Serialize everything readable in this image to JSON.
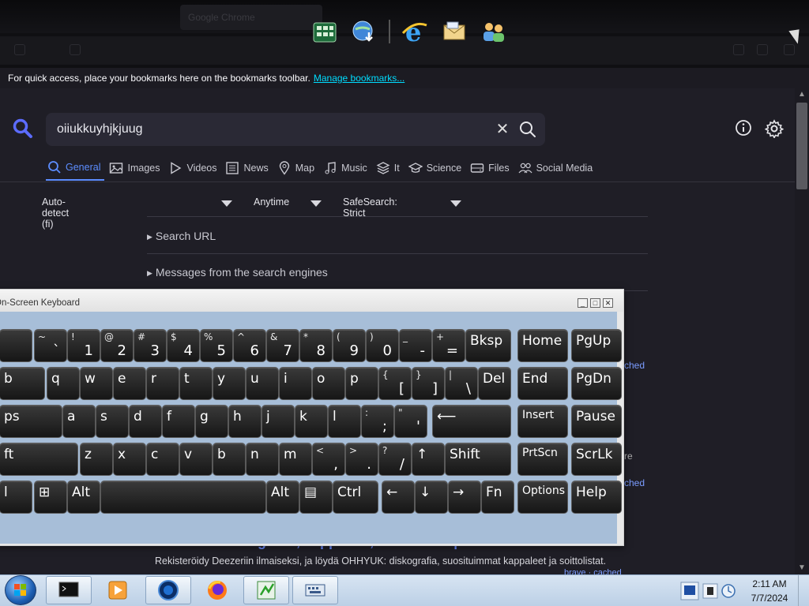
{
  "browser": {
    "tab_title": "Google Chrome",
    "bookmarks_bar": {
      "message": "For quick access, place your bookmarks here on the bookmarks toolbar.",
      "link": "Manage bookmarks..."
    }
  },
  "quick_launch": [
    {
      "icon": "app-grid-icon"
    },
    {
      "icon": "globe-download-icon"
    },
    {
      "icon": "internet-explorer-icon"
    },
    {
      "icon": "mail-icon"
    },
    {
      "icon": "users-icon"
    }
  ],
  "search": {
    "query": "oiiukkuyhjkjuug",
    "categories": [
      {
        "label": "General",
        "icon": "search-icon",
        "active": true
      },
      {
        "label": "Images",
        "icon": "image-icon"
      },
      {
        "label": "Videos",
        "icon": "play-icon"
      },
      {
        "label": "News",
        "icon": "newspaper-icon"
      },
      {
        "label": "Map",
        "icon": "map-pin-icon"
      },
      {
        "label": "Music",
        "icon": "music-icon"
      },
      {
        "label": "It",
        "icon": "layers-icon"
      },
      {
        "label": "Science",
        "icon": "graduation-cap-icon"
      },
      {
        "label": "Files",
        "icon": "drive-icon"
      },
      {
        "label": "Social Media",
        "icon": "people-icon"
      }
    ],
    "filters": {
      "language": "Auto-detect (fi)",
      "time": "Anytime",
      "safesearch": "SafeSearch: Strict"
    },
    "disclosures": {
      "search_url": "Search URL",
      "messages": "Messages from the search engines"
    },
    "side_snippets": {
      "cached1": "ched",
      "re": "re",
      "cached2": "ched"
    },
    "result": {
      "title": "OHHYUK diskografia, kappaleet, soittolistat | Kuuntele Deezerissä",
      "description": "Rekisteröidy Deezeriin ilmaiseksi, ja löydä OHHYUK: diskografia, suosituimmat kappaleet ja soittolistat.",
      "meta": "brave  ·  cached"
    }
  },
  "osk": {
    "title": "On-Screen Keyboard",
    "rows": [
      [
        {
          "top": "",
          "bot": "",
          "lbl": ""
        },
        {
          "top": "~",
          "bot": "`"
        },
        {
          "top": "!",
          "bot": "1"
        },
        {
          "top": "@",
          "bot": "2"
        },
        {
          "top": "#",
          "bot": "3"
        },
        {
          "top": "$",
          "bot": "4"
        },
        {
          "top": "%",
          "bot": "5"
        },
        {
          "top": "^",
          "bot": "6"
        },
        {
          "top": "&",
          "bot": "7"
        },
        {
          "top": "*",
          "bot": "8"
        },
        {
          "top": "(",
          "bot": "9"
        },
        {
          "top": ")",
          "bot": "0"
        },
        {
          "top": "_",
          "bot": "-"
        },
        {
          "top": "+",
          "bot": "="
        },
        {
          "lbl": "Bksp"
        },
        {
          "lbl": "Home"
        },
        {
          "lbl": "PgUp"
        }
      ],
      [
        {
          "lbl": "b"
        },
        {
          "lbl": "q"
        },
        {
          "lbl": "w"
        },
        {
          "lbl": "e"
        },
        {
          "lbl": "r"
        },
        {
          "lbl": "t"
        },
        {
          "lbl": "y"
        },
        {
          "lbl": "u"
        },
        {
          "lbl": "i"
        },
        {
          "lbl": "o"
        },
        {
          "lbl": "p"
        },
        {
          "top": "{",
          "bot": "["
        },
        {
          "top": "}",
          "bot": "]"
        },
        {
          "top": "|",
          "bot": "\\"
        },
        {
          "lbl": "Del"
        },
        {
          "lbl": "End"
        },
        {
          "lbl": "PgDn"
        }
      ],
      [
        {
          "lbl": "ps"
        },
        {
          "lbl": "a"
        },
        {
          "lbl": "s"
        },
        {
          "lbl": "d"
        },
        {
          "lbl": "f"
        },
        {
          "lbl": "g"
        },
        {
          "lbl": "h"
        },
        {
          "lbl": "j"
        },
        {
          "lbl": "k"
        },
        {
          "lbl": "l"
        },
        {
          "top": ":",
          "bot": ";"
        },
        {
          "top": "\"",
          "bot": "'"
        },
        {
          "lbl": "⟵"
        },
        {
          "lbl": "Insert"
        },
        {
          "lbl": "Pause"
        }
      ],
      [
        {
          "lbl": "ft"
        },
        {
          "lbl": "z"
        },
        {
          "lbl": "x"
        },
        {
          "lbl": "c"
        },
        {
          "lbl": "v"
        },
        {
          "lbl": "b"
        },
        {
          "lbl": "n"
        },
        {
          "lbl": "m"
        },
        {
          "top": "<",
          "bot": ","
        },
        {
          "top": ">",
          "bot": "."
        },
        {
          "top": "?",
          "bot": "/"
        },
        {
          "lbl": "↑"
        },
        {
          "lbl": "Shift"
        },
        {
          "lbl": "PrtScn"
        },
        {
          "lbl": "ScrLk"
        }
      ],
      [
        {
          "lbl": "l"
        },
        {
          "lbl": "⊞"
        },
        {
          "lbl": "Alt"
        },
        {
          "lbl": ""
        },
        {
          "lbl": "Alt"
        },
        {
          "lbl": "▤"
        },
        {
          "lbl": "Ctrl"
        },
        {
          "lbl": "←"
        },
        {
          "lbl": "↓"
        },
        {
          "lbl": "→"
        },
        {
          "lbl": "Fn"
        },
        {
          "lbl": "Options"
        },
        {
          "lbl": "Help"
        }
      ]
    ]
  },
  "taskbar": {
    "items": [
      {
        "icon": "terminal-icon",
        "active": true
      },
      {
        "icon": "media-player-icon",
        "active": false
      },
      {
        "icon": "globe-app-icon",
        "active": true
      },
      {
        "icon": "firefox-icon",
        "active": false
      },
      {
        "icon": "spreadsheet-icon",
        "active": true
      },
      {
        "icon": "keyboard-icon",
        "active": true
      }
    ],
    "clock": {
      "time": "2:11 AM",
      "date": "7/7/2024"
    }
  },
  "colors": {
    "accent": "#5c8dff",
    "link": "#00ddff",
    "page_bg": "#1f1e26",
    "osk_body": "#a7bed8"
  }
}
